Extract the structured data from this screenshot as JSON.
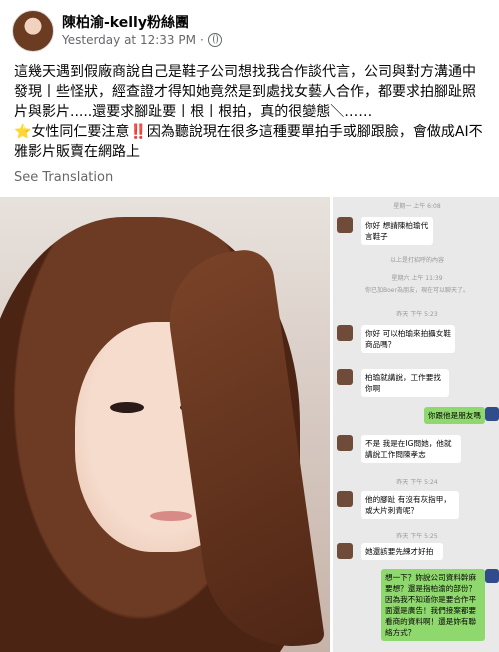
{
  "post": {
    "author": "陳柏渝-kelly粉絲團",
    "timestamp": "Yesterday at 12:33 PM",
    "globe_sep": "·",
    "text_1": "這幾天遇到假廠商說自己是鞋子公司想找我合作談代言，公司與對方溝通中發現丨些怪狀，經查證才得知她竟然是到處找女藝人合作，都要求拍腳趾照片與影片.....還要求腳趾要丨根丨根拍，真的很變態＼……",
    "text_2_prefix": "⭐",
    "text_2_main": "女性同仁要注意",
    "text_2_bang": "‼️",
    "text_2_suffix": "因為聽說現在很多這種要單拍手或腳跟臉，會做成AI不雅影片販賣在網路上",
    "see_translation": "See Translation",
    "icons": {
      "globe": "globe-icon",
      "avatar": "profile-avatar"
    },
    "colors": {
      "meta": "#65676b",
      "star": "#f5c518",
      "bang": "#e41e3f",
      "green_bubble": "#8fd86d"
    }
  },
  "chat": {
    "dates": [
      "星期一 上午 6:08",
      "星期六 上午 11:39",
      "昨天 下午 5:23",
      "昨天 下午 5:24",
      "昨天 下午 5:25"
    ],
    "messages": [
      {
        "side": "left",
        "text": "你好 想請陳柏瑜代言鞋子"
      },
      {
        "side": "system",
        "text": "以上是打招呼的內容"
      },
      {
        "side": "system",
        "text": "你已加Boer為朋友，現在可以聊天了。"
      },
      {
        "side": "left",
        "text": "你好 可以柏瑜來拍攝女鞋商品嗎？"
      },
      {
        "side": "left",
        "text": "柏瑜就講說，工作要找你啊"
      },
      {
        "side": "right",
        "text": "你跟他是朋友嗎"
      },
      {
        "side": "left",
        "text": "不是 我是在IG問她，他就講說工作問陳孝志"
      },
      {
        "side": "left",
        "text": "他的腳趾 有沒有灰指甲，或大片刺青呢？"
      },
      {
        "side": "left",
        "text": "她還該要先練才好拍"
      },
      {
        "side": "right",
        "text": "想一下？妳說公司資料幹麻要想？還是指柏渝的部份？因為我不知道你是要合作平面還是廣告！我們接案都要看商的資料啊！還是妳有聯絡方式？"
      }
    ]
  }
}
